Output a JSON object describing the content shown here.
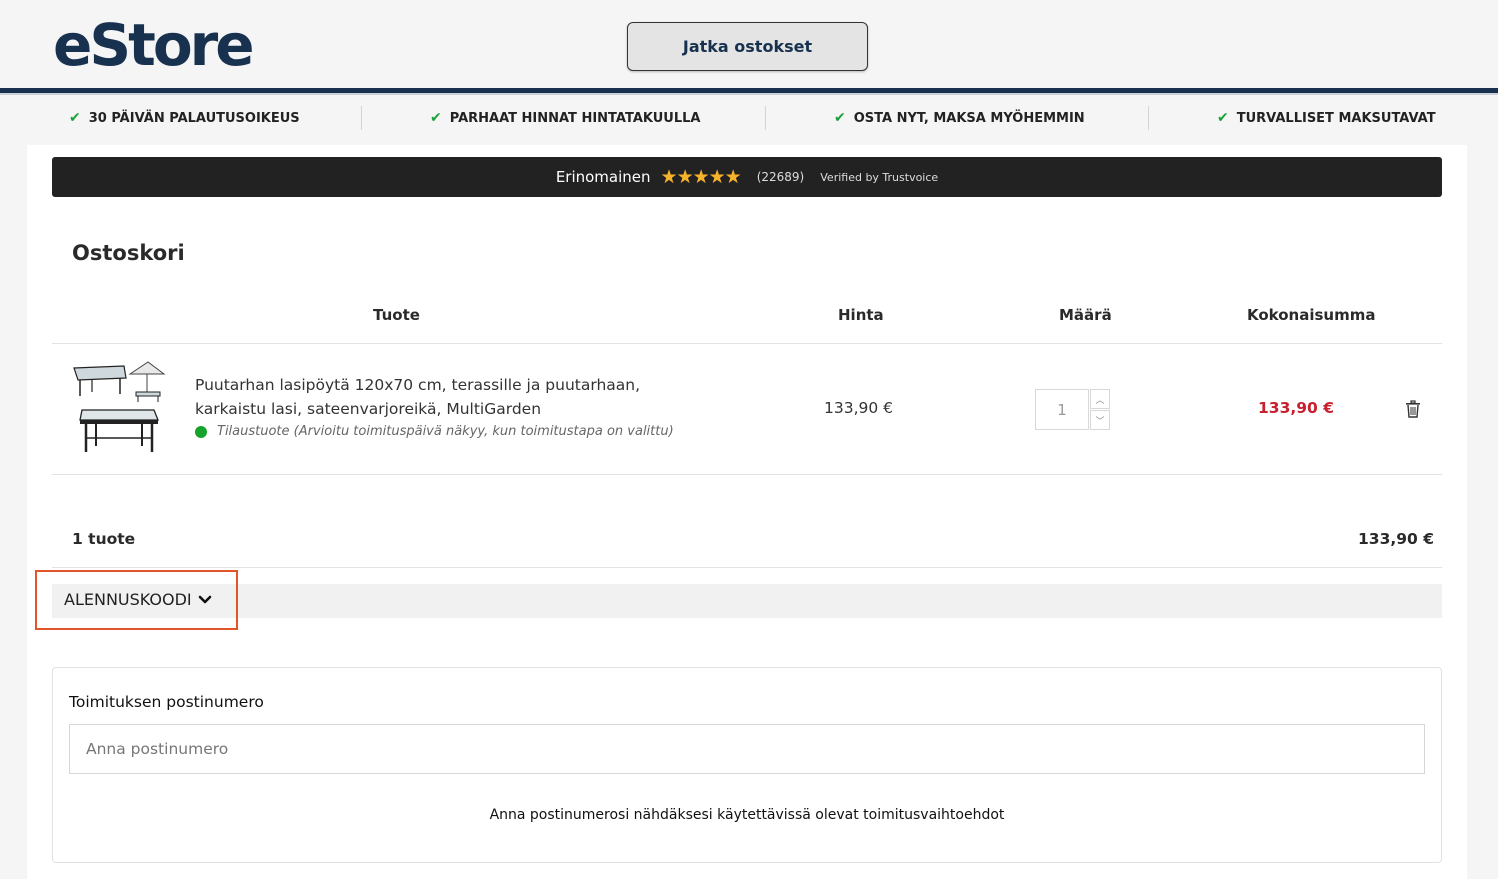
{
  "header": {
    "logo_text": "eStore",
    "continue_button": "Jatka ostokset",
    "brand_color": "#17314f"
  },
  "usp": [
    {
      "label": "30 PÄIVÄN PALAUTUSOIKEUS"
    },
    {
      "label": "PARHAAT HINNAT HINTATAKUULLA"
    },
    {
      "label": "OSTA NYT, MAKSA MYÖHEMMIN"
    },
    {
      "label": "TURVALLISET MAKSUTAVAT"
    }
  ],
  "trust": {
    "rating_label": "Erinomainen",
    "stars": "★★★★★",
    "count": "(22689)",
    "verified": "Verified by Trustvoice"
  },
  "cart": {
    "title": "Ostoskori",
    "columns": {
      "product": "Tuote",
      "price": "Hinta",
      "quantity": "Määrä",
      "total": "Kokonaisumma"
    },
    "items": [
      {
        "name": "Puutarhan lasipöytä 120x70 cm, terassille ja puutarhaan, karkaistu lasi, sateenvarjoreikä, MultiGarden",
        "status": "Tilaustuote (Arvioitu toimituspäivä näkyy, kun toimitustapa on valittu)",
        "price": "133,90 €",
        "quantity": "1",
        "total": "133,90 €"
      }
    ],
    "summary_count": "1 tuote",
    "summary_total": "133,90 €",
    "discount_label": "ALENNUSKOODI"
  },
  "shipping": {
    "label": "Toimituksen postinumero",
    "placeholder": "Anna postinumero",
    "hint": "Anna postinumerosi nähdäksesi käytettävissä olevat toimitusvaihtoehdot"
  },
  "colors": {
    "accent_red": "#c8202f",
    "check_green": "#1aa33a",
    "star_gold": "#f6b32b",
    "highlight_orange": "#e2542a"
  }
}
